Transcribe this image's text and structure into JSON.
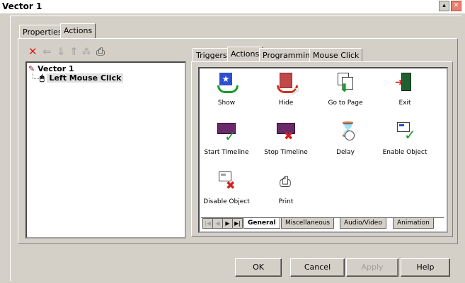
{
  "window": {
    "title": "Vector 1"
  },
  "tabs": [
    {
      "label": "Properties"
    },
    {
      "label": "Actions"
    }
  ],
  "tree": {
    "root": "Vector 1",
    "child": "Left Mouse Click"
  },
  "inner_tabs": [
    {
      "label": "Triggers"
    },
    {
      "label": "Actions"
    },
    {
      "label": "Programming"
    },
    {
      "label": "Mouse Click"
    }
  ],
  "actions": [
    {
      "label": "Show",
      "icon": "show-icon"
    },
    {
      "label": "Hide",
      "icon": "hide-icon"
    },
    {
      "label": "Go to Page",
      "icon": "go-to-page-icon"
    },
    {
      "label": "Exit",
      "icon": "exit-icon"
    },
    {
      "label": "Start Timeline",
      "icon": "start-timeline-icon"
    },
    {
      "label": "Stop Timeline",
      "icon": "stop-timeline-icon"
    },
    {
      "label": "Delay",
      "icon": "delay-icon"
    },
    {
      "label": "Enable Object",
      "icon": "enable-object-icon"
    },
    {
      "label": "Disable Object",
      "icon": "disable-object-icon"
    },
    {
      "label": "Print",
      "icon": "print-icon"
    }
  ],
  "category_tabs": [
    {
      "label": "General"
    },
    {
      "label": "Miscellaneous"
    },
    {
      "label": "Audio/Video"
    },
    {
      "label": "Animation"
    }
  ],
  "buttons": {
    "ok": "OK",
    "cancel": "Cancel",
    "apply": "Apply",
    "help": "Help"
  },
  "colors": {
    "delete": "#e02020",
    "accent": "#1f4fb8"
  }
}
